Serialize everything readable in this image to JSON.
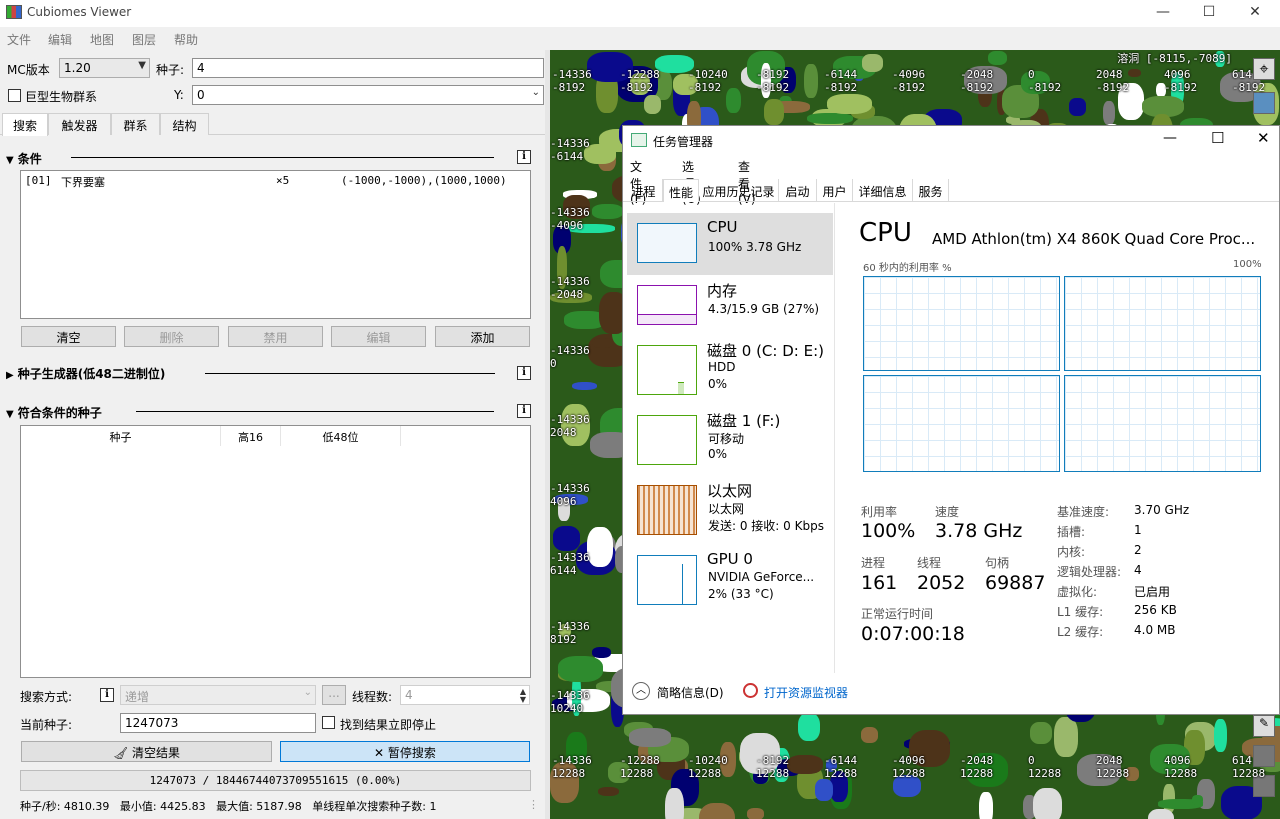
{
  "window": {
    "title": "Cubiomes Viewer"
  },
  "menu": [
    "文件",
    "编辑",
    "地图",
    "图层",
    "帮助"
  ],
  "settings": {
    "mc_label": "MC版本",
    "mc_value": "1.20",
    "seed_label": "种子:",
    "seed_value": "4",
    "large_biomes_label": "巨型生物群系",
    "y_label": "Y:",
    "y_value": "0"
  },
  "tabs": [
    "搜索",
    "触发器",
    "群系",
    "结构"
  ],
  "conditions": {
    "title": "条件",
    "row": {
      "id": "[01]",
      "name": "下界要塞",
      "count": "×5",
      "area": "(-1000,-1000),(1000,1000)"
    },
    "buttons": [
      "清空",
      "删除",
      "禁用",
      "编辑",
      "添加"
    ]
  },
  "generator": {
    "title": "种子生成器(低48二进制位)"
  },
  "results": {
    "title": "符合条件的种子",
    "columns": [
      "种子",
      "高16",
      "低48位"
    ]
  },
  "search": {
    "mode_label": "搜索方式:",
    "mode_value": "递增",
    "more": "...",
    "threads_label": "线程数:",
    "threads_value": "4",
    "current_label": "当前种子:",
    "current_value": "1247073",
    "stop_label": "找到结果立即停止",
    "clear_label": "清空结果",
    "pause_label": "暂停搜索",
    "progress_text": "1247073 / 18446744073709551615 (0.00%)",
    "progress_fraction": 0.0,
    "stats": "种子/秒: 4810.39   最小值: 4425.83   最大值: 5187.98   单线程单次搜索种子数: 1"
  },
  "map": {
    "header": "溶洞 [-8115,-7089]",
    "top_x": [
      "-14336",
      "-12288",
      "-10240",
      "-8192",
      "-6144",
      "-4096",
      "-2048",
      "0",
      "2048",
      "4096",
      "614"
    ],
    "top_z": "-8192",
    "left_x": "-14336",
    "left_z": [
      "-8192",
      "-6144",
      "-4096",
      "-2048",
      "0",
      "2048",
      "4096",
      "6144",
      "8192",
      "10240",
      "12288"
    ],
    "bottom_x": [
      "-14336",
      "-12288",
      "-10240",
      "-8192",
      "-6144",
      "-4096",
      "-2048",
      "0",
      "2048",
      "4096",
      "614"
    ],
    "bottom_z": "12288"
  },
  "taskmgr": {
    "title": "任务管理器",
    "menu": [
      "文件(F)",
      "选项(O)",
      "查看(V)"
    ],
    "tabs": [
      "进程",
      "性能",
      "应用历史记录",
      "启动",
      "用户",
      "详细信息",
      "服务"
    ],
    "side": [
      {
        "name": "CPU",
        "sub1": "100% 3.78 GHz",
        "sub2": "",
        "sub3": ""
      },
      {
        "name": "内存",
        "sub1": "4.3/15.9 GB (27%)",
        "sub2": "",
        "sub3": ""
      },
      {
        "name": "磁盘 0 (C: D: E:)",
        "sub1": "HDD",
        "sub2": "0%",
        "sub3": ""
      },
      {
        "name": "磁盘 1 (F:)",
        "sub1": "可移动",
        "sub2": "0%",
        "sub3": ""
      },
      {
        "name": "以太网",
        "sub1": "以太网",
        "sub2": "发送: 0 接收: 0 Kbps",
        "sub3": ""
      },
      {
        "name": "GPU 0",
        "sub1": "NVIDIA GeForce...",
        "sub2": "2% (33 °C)",
        "sub3": ""
      }
    ],
    "cpu_title": "CPU",
    "cpu_model": "AMD Athlon(tm) X4 860K Quad Core Proc...",
    "graph_label": "60 秒内的利用率 %",
    "graph_max": "100%",
    "stats": {
      "util_label": "利用率",
      "util": "100%",
      "speed_label": "速度",
      "speed": "3.78 GHz",
      "proc_label": "进程",
      "proc": "161",
      "thread_label": "线程",
      "thread": "2052",
      "handle_label": "句柄",
      "handle": "69887",
      "uptime_label": "正常运行时间",
      "uptime": "0:07:00:18"
    },
    "details": [
      {
        "k": "基准速度:",
        "v": "3.70 GHz"
      },
      {
        "k": "插槽:",
        "v": "1"
      },
      {
        "k": "内核:",
        "v": "2"
      },
      {
        "k": "逻辑处理器:",
        "v": "4"
      },
      {
        "k": "虚拟化:",
        "v": "已启用"
      },
      {
        "k": "L1 缓存:",
        "v": "256 KB"
      },
      {
        "k": "L2 缓存:",
        "v": "4.0 MB"
      }
    ],
    "footer_less": "简略信息(D)",
    "footer_monitor": "打开资源监视器"
  }
}
